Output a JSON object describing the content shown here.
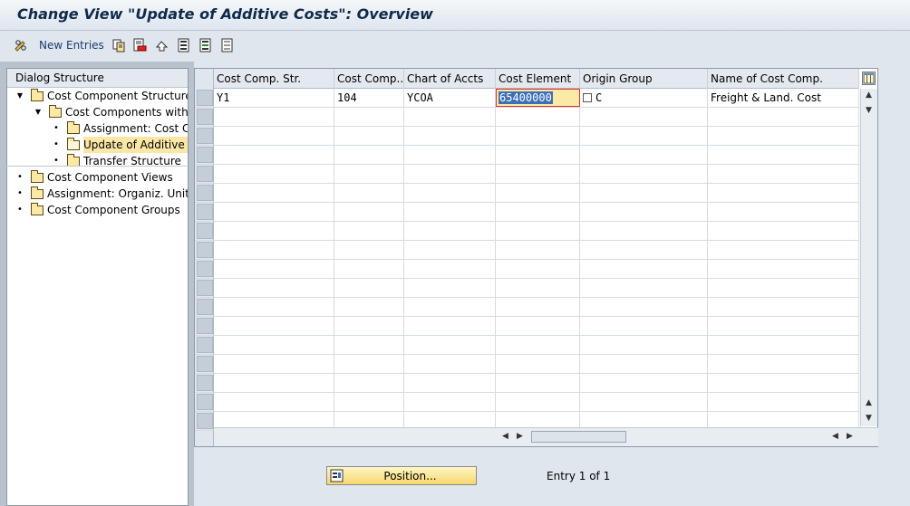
{
  "window": {
    "title": "Change View \"Update of Additive Costs\": Overview"
  },
  "toolbar": {
    "new_entries_label": "New Entries",
    "icons": [
      "glasses-pencil-icon",
      "copy-icon",
      "delete-icon",
      "undo-icon",
      "select-all-icon",
      "select-block-icon",
      "deselect-all-icon"
    ]
  },
  "dialog_structure": {
    "title": "Dialog Structure",
    "items": [
      {
        "label": "Cost Component Structure",
        "level": 0,
        "expanded": true
      },
      {
        "label": "Cost Components with A",
        "level": 1,
        "expanded": true
      },
      {
        "label": "Assignment: Cost Co",
        "level": 2
      },
      {
        "label": "Update of Additive C",
        "level": 2,
        "selected": true
      },
      {
        "label": "Transfer Structure",
        "level": 2
      },
      {
        "label": "Cost Component Views",
        "level": 0
      },
      {
        "label": "Assignment: Organiz. Units -",
        "level": 0
      },
      {
        "label": "Cost Component Groups",
        "level": 0
      }
    ]
  },
  "table": {
    "columns": [
      "Cost Comp. Str.",
      "Cost Comp...",
      "Chart of Accts",
      "Cost Element",
      "Origin Group",
      "Name of Cost Comp."
    ],
    "rows": [
      [
        "Y1",
        "104",
        "YCOA",
        "65400000",
        "C",
        "Freight & Land. Cost"
      ]
    ],
    "empty_rows": 17
  },
  "footer": {
    "position_button_label": "Position...",
    "entry_text": "Entry 1 of 1"
  }
}
